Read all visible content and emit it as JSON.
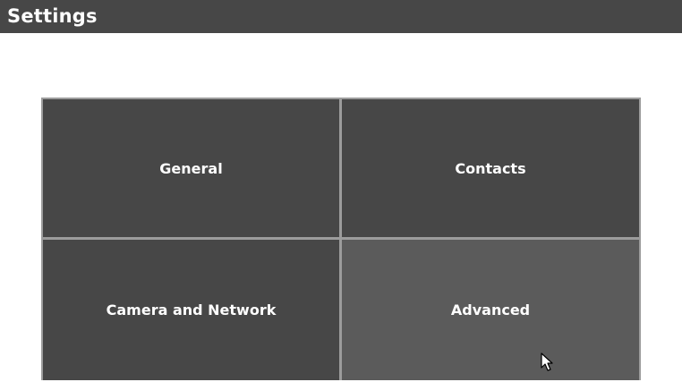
{
  "header": {
    "title": "Settings"
  },
  "tiles": [
    {
      "label": "General"
    },
    {
      "label": "Contacts"
    },
    {
      "label": "Camera and Network"
    },
    {
      "label": "Advanced"
    }
  ],
  "hovered_tile": "Advanced",
  "colors": {
    "header_bg": "#474747",
    "tile_bg": "#474747",
    "tile_hover_bg": "#5b5b5b",
    "tile_border": "#9c9c9c",
    "text": "#ffffff"
  },
  "icons": [
    "mouse-pointer-icon"
  ]
}
